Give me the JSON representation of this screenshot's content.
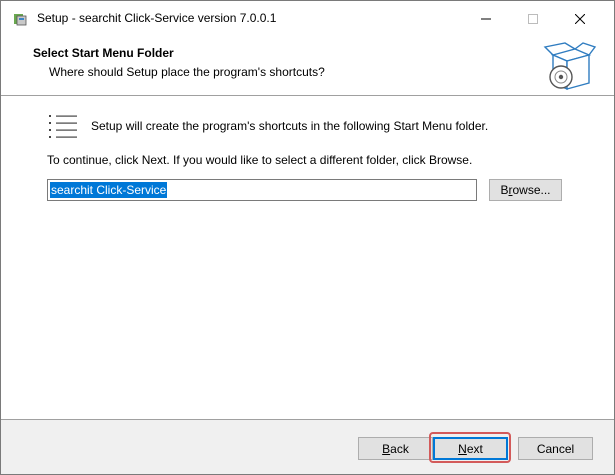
{
  "window": {
    "title": "Setup - searchit Click-Service version 7.0.0.1"
  },
  "header": {
    "title": "Select Start Menu Folder",
    "subtitle": "Where should Setup place the program's shortcuts?",
    "graphic_icon": "box-disc-icon"
  },
  "body": {
    "info_text": "Setup will create the program's shortcuts in the following Start Menu folder.",
    "continue_text": "To continue, click Next. If you would like to select a different folder, click Browse.",
    "folder_value": "searchit Click-Service",
    "browse_label_prefix": "B",
    "browse_label_accel": "r",
    "browse_label_rest": "owse..."
  },
  "footer": {
    "back_accel": "B",
    "back_rest": "ack",
    "next_accel": "N",
    "next_rest": "ext",
    "cancel_label": "Cancel"
  },
  "colors": {
    "selection": "#0078d7",
    "highlight_outline": "#d35a5a",
    "window_bg": "#f0f0f0"
  }
}
